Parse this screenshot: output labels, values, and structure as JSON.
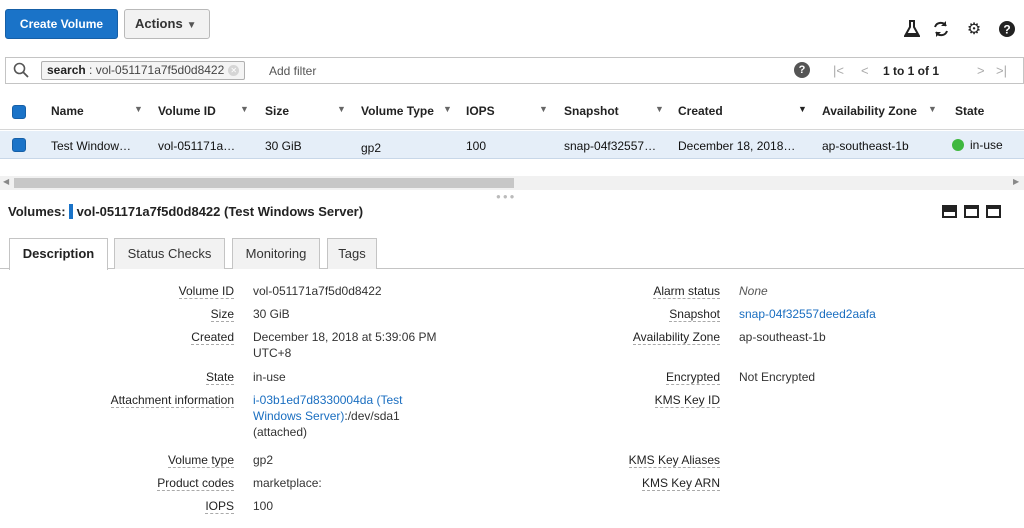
{
  "toolbar": {
    "create_label": "Create Volume",
    "actions_label": "Actions",
    "icons": [
      "flask-icon",
      "refresh-icon",
      "gear-icon",
      "help-icon"
    ]
  },
  "filter": {
    "token_key": "search",
    "token_value": " : vol-051171a7f5d0d8422",
    "add_placeholder": "Add filter",
    "pager_range": "1 to 1 of 1"
  },
  "table": {
    "headers": [
      "Name",
      "Volume ID",
      "Size",
      "Volume Type",
      "IOPS",
      "Snapshot",
      "Created",
      "Availability Zone",
      "State"
    ],
    "row": {
      "name": "Test Window…",
      "volume_id": "vol-051171a…",
      "size": "30 GiB",
      "volume_type": "gp2",
      "iops": "100",
      "snapshot": "snap-04f32557…",
      "created": "December 18, 2018…",
      "zone": "ap-southeast-1b",
      "state": "in-use"
    },
    "state_color": "#3fb83f"
  },
  "detail": {
    "title_prefix": "Volumes:",
    "title_value": "vol-051171a7f5d0d8422 (Test Windows Server)",
    "tabs": [
      "Description",
      "Status Checks",
      "Monitoring",
      "Tags"
    ],
    "left": {
      "volume_id_label": "Volume ID",
      "volume_id": "vol-051171a7f5d0d8422",
      "size_label": "Size",
      "size": "30 GiB",
      "created_label": "Created",
      "created_1": "December 18, 2018 at 5:39:06 PM",
      "created_2": "UTC+8",
      "state_label": "State",
      "state": "in-use",
      "attach_label": "Attachment information",
      "attach_link_1": "i-03b1ed7d8330004da (Test",
      "attach_link_2": "Windows Server)",
      "attach_suffix": ":/dev/sda1",
      "attach_note": "(attached)",
      "vtype_label": "Volume type",
      "vtype": "gp2",
      "pcodes_label": "Product codes",
      "pcodes": "marketplace:",
      "iops_label": "IOPS",
      "iops": "100"
    },
    "right": {
      "alarm_label": "Alarm status",
      "alarm": "None",
      "snapshot_label": "Snapshot",
      "snapshot": "snap-04f32557deed2aafa",
      "zone_label": "Availability Zone",
      "zone": "ap-southeast-1b",
      "enc_label": "Encrypted",
      "enc": "Not Encrypted",
      "kms_id_label": "KMS Key ID",
      "kms_alias_label": "KMS Key Aliases",
      "kms_arn_label": "KMS Key ARN"
    }
  },
  "colors": {
    "primary": "#1a73c8",
    "selected_row": "#e5eef8",
    "link": "#1a6ec0"
  }
}
